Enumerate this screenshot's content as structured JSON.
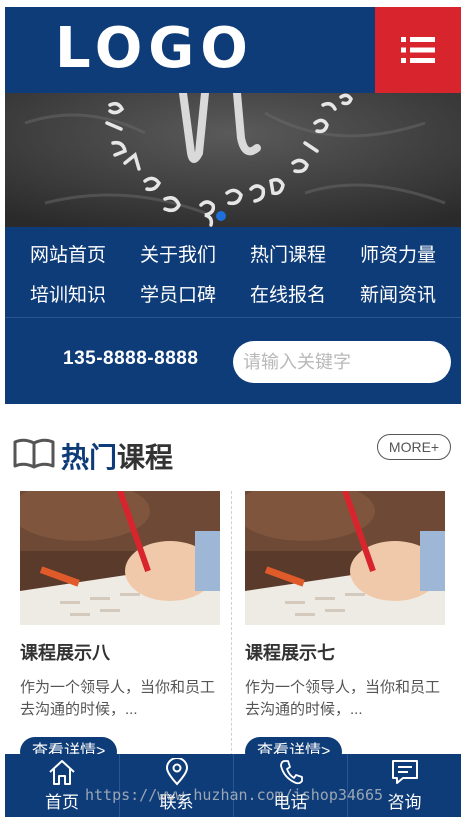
{
  "header": {
    "logo_text": "LOGO",
    "menu_icon": "list-menu-icon"
  },
  "banner": {
    "active_slide": 1,
    "slide_count": 1
  },
  "nav": {
    "items": [
      {
        "label": "网站首页"
      },
      {
        "label": "关于我们"
      },
      {
        "label": "热门课程"
      },
      {
        "label": "师资力量"
      },
      {
        "label": "培训知识"
      },
      {
        "label": "学员口碑"
      },
      {
        "label": "在线报名"
      },
      {
        "label": "新闻资讯"
      }
    ]
  },
  "search": {
    "phone": "135-8888-8888",
    "placeholder": "请输入关键字"
  },
  "section": {
    "title_highlight": "热门",
    "title_rest": "课程",
    "more_label": "MORE+"
  },
  "courses": [
    {
      "title": "课程展示八",
      "desc": "作为一个领导人，当你和员工去沟通的时候，...",
      "button": "查看详情>"
    },
    {
      "title": "课程展示七",
      "desc": "作为一个领导人，当你和员工去沟通的时候，...",
      "button": "查看详情>"
    }
  ],
  "footer": {
    "items": [
      {
        "label": "首页",
        "icon": "home-icon"
      },
      {
        "label": "联系",
        "icon": "location-pin-icon"
      },
      {
        "label": "电话",
        "icon": "phone-icon"
      },
      {
        "label": "咨询",
        "icon": "chat-icon"
      }
    ]
  },
  "watermark": "https://www.huzhan.com/ishop34665",
  "colors": {
    "primary": "#0e3c78",
    "accent": "#d8242c",
    "banner_dot": "#1e6fd9"
  }
}
